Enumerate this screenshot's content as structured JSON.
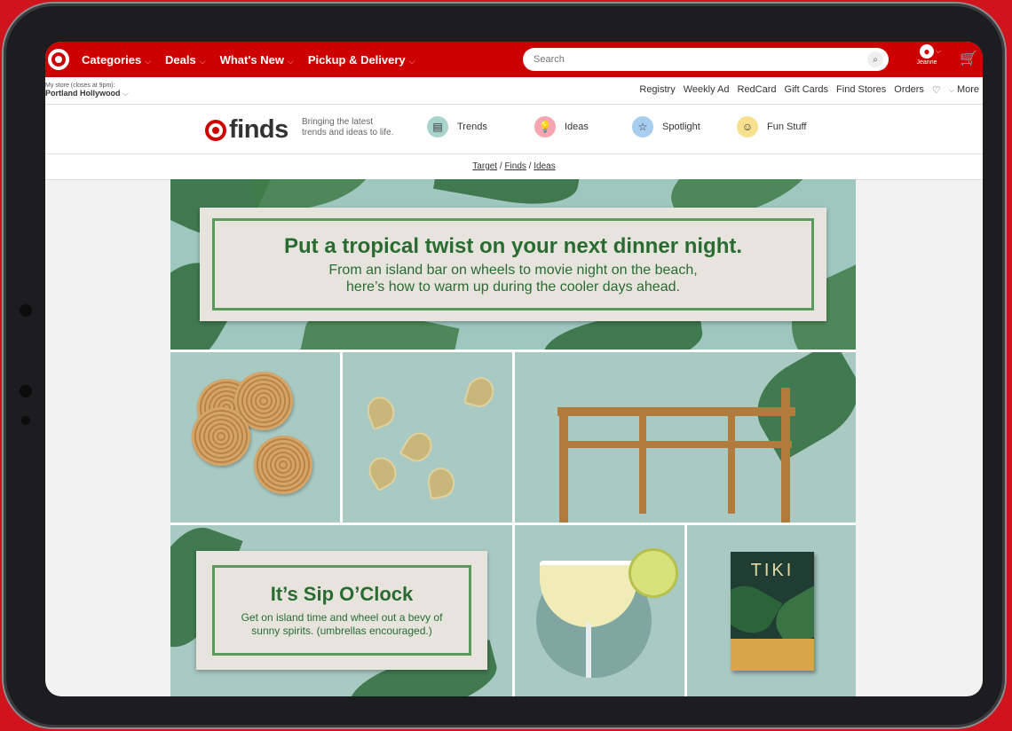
{
  "nav": {
    "links": [
      "Categories",
      "Deals",
      "What's New",
      "Pickup & Delivery"
    ],
    "search_placeholder": "Search",
    "account_name": "Jeanne"
  },
  "store": {
    "label": "My store (closes at 9pm):",
    "name": "Portland Hollywood"
  },
  "utility_links": [
    "Registry",
    "Weekly Ad",
    "RedCard",
    "Gift Cards",
    "Find Stores",
    "Orders",
    "More"
  ],
  "finds": {
    "logo_text": "finds",
    "tagline": "Bringing the latest trends and ideas to life.",
    "nav": [
      {
        "label": "Trends",
        "icon": "chart-icon",
        "color": "#a9d3cd"
      },
      {
        "label": "Ideas",
        "icon": "lightbulb-icon",
        "color": "#f5a6b1"
      },
      {
        "label": "Spotlight",
        "icon": "star-icon",
        "color": "#a8cdee"
      },
      {
        "label": "Fun Stuff",
        "icon": "smiley-icon",
        "color": "#f7e08f"
      }
    ]
  },
  "breadcrumb": [
    "Target",
    "Finds",
    "Ideas"
  ],
  "hero": {
    "title": "Put a tropical twist on your next dinner night.",
    "subtitle_line1": "From an island bar on wheels to movie night on the beach,",
    "subtitle_line2": "here’s how to warm up during the cooler days ahead."
  },
  "sip": {
    "title": "It’s Sip O’Clock",
    "body_line1": "Get on island time and wheel out a bevy of",
    "body_line2": "sunny spirits. (umbrellas encouraged.)"
  },
  "book_title": "TIKI",
  "colors": {
    "brand_red": "#cc0000",
    "tile_teal": "#a9c9c3",
    "finds_green": "#2a6b32"
  }
}
